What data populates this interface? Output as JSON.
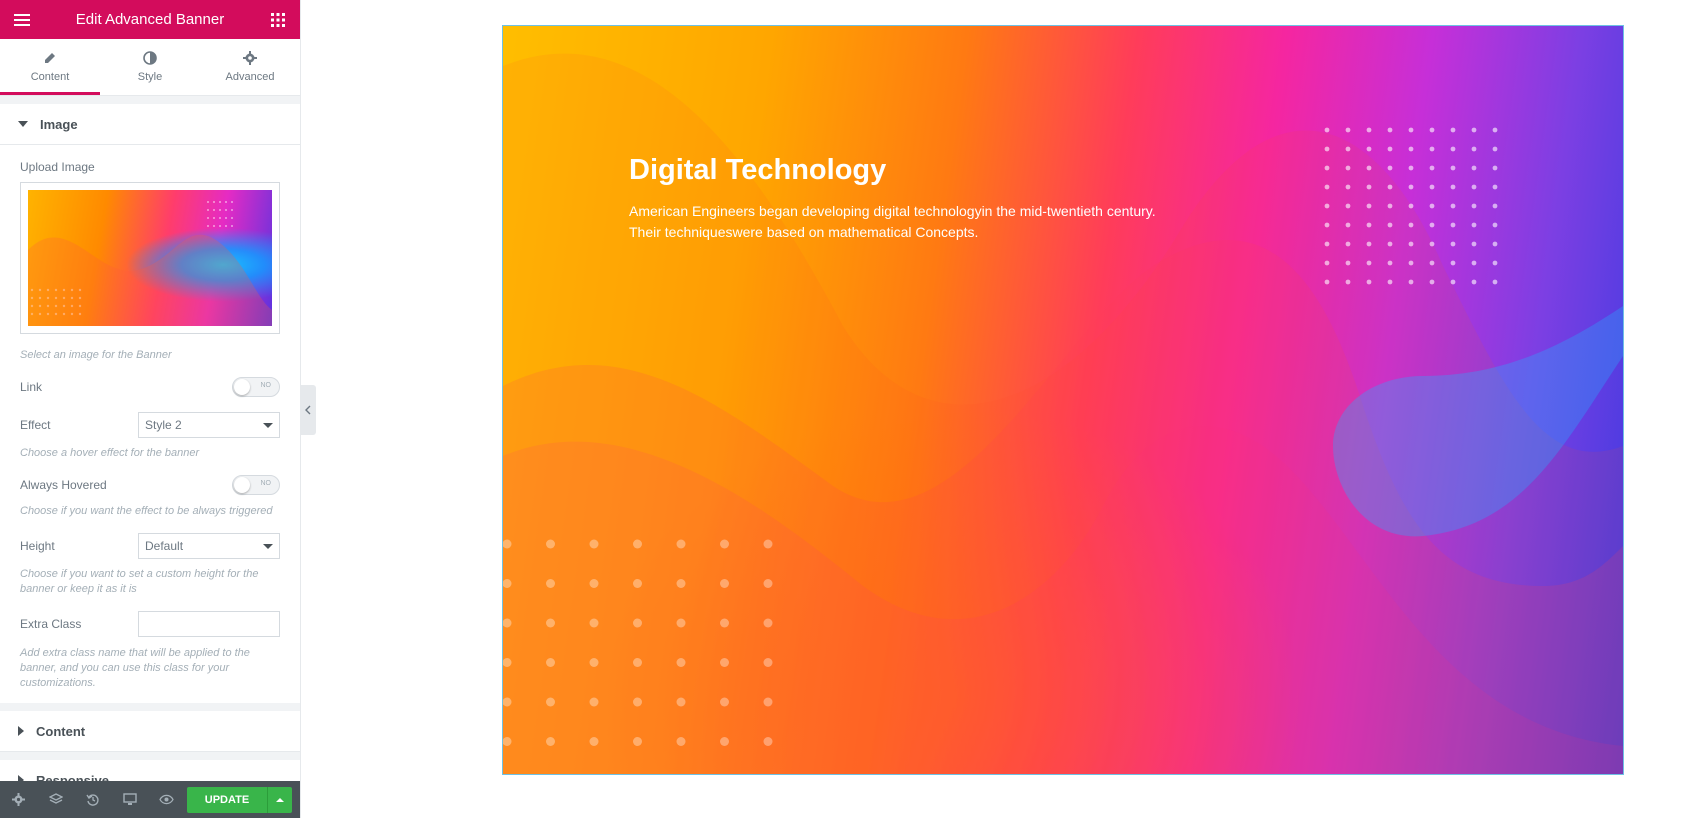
{
  "header": {
    "title": "Edit Advanced Banner"
  },
  "tabs": [
    {
      "label": "Content",
      "icon": "pencil-icon"
    },
    {
      "label": "Style",
      "icon": "half-circle-icon"
    },
    {
      "label": "Advanced",
      "icon": "gear-icon"
    }
  ],
  "image_section": {
    "title": "Image",
    "upload_label": "Upload Image",
    "upload_hint": "Select an image for the Banner",
    "link_label": "Link",
    "link_toggle": "NO",
    "effect_label": "Effect",
    "effect_value": "Style 2",
    "effect_hint": "Choose a hover effect for the banner",
    "always_hovered_label": "Always Hovered",
    "always_hovered_toggle": "NO",
    "always_hovered_hint": "Choose if you want the effect to be always triggered",
    "height_label": "Height",
    "height_value": "Default",
    "height_hint": "Choose if you want to set a custom height for the banner or keep it as it is",
    "extra_class_label": "Extra Class",
    "extra_class_value": "",
    "extra_class_hint": "Add extra class name that will be applied to the banner, and you can use this class for your customizations."
  },
  "sections": {
    "content": "Content",
    "responsive": "Responsive"
  },
  "footer": {
    "update_label": "UPDATE"
  },
  "banner": {
    "title": "Digital Technology",
    "description_line1": "American Engineers began developing digital technologyin the mid-twentieth century.",
    "description_line2": "Their techniqueswere based on mathematical Concepts."
  },
  "colors": {
    "brand": "#d30c5c",
    "update": "#39b54a",
    "footer": "#495157"
  }
}
